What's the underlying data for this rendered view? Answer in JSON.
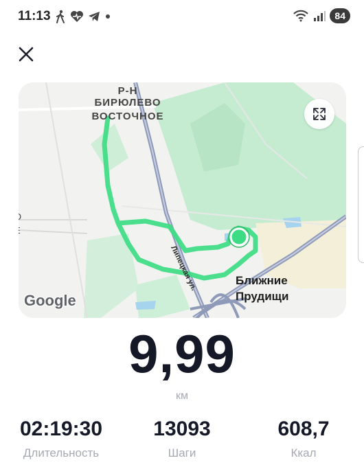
{
  "status_bar": {
    "time": "11:13",
    "battery": "84",
    "icons": [
      "walking-icon",
      "heart-icon",
      "telegram-icon",
      "dot-icon",
      "wifi-icon",
      "signal-icon"
    ]
  },
  "map": {
    "district_label_line1": "Р-Н БИРЮЛЕВО",
    "district_label_line2": "ВОСТОЧНОЕ",
    "place_label_line1": "Ближние",
    "place_label_line2": "Прудищи",
    "street_label": "Липецкая ул.",
    "edge_label_1": "О",
    "edge_label_2": "Е",
    "google_logo": "Google",
    "route_color": "#3ddc84",
    "park_color": "#c5ecd1",
    "road_color": "#8f9ab8"
  },
  "summary": {
    "distance_value": "9,99",
    "distance_unit": "км"
  },
  "stats": [
    {
      "value": "02:19:30",
      "label": "Длительность"
    },
    {
      "value": "13093",
      "label": "Шаги"
    },
    {
      "value": "608,7",
      "label": "Ккал"
    }
  ]
}
